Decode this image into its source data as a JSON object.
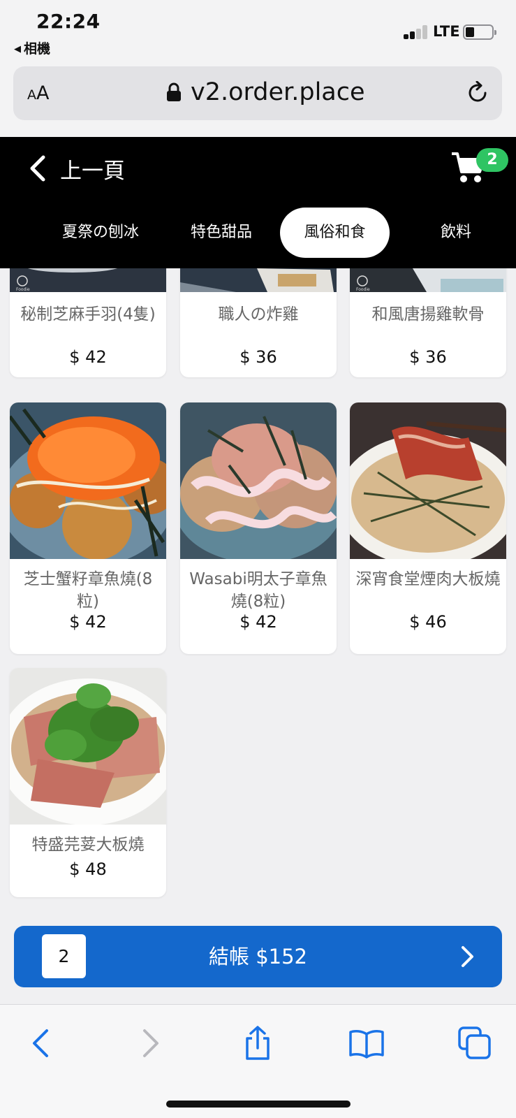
{
  "status_bar": {
    "time": "22:24",
    "back_app": "相機",
    "network": "LTE"
  },
  "browser": {
    "text_size": "AA",
    "url": "v2.order.place"
  },
  "header": {
    "back_label": "上一頁",
    "cart_count": "2"
  },
  "tabs": [
    {
      "label": "夏祭の刨冰",
      "active": false
    },
    {
      "label": "特色甜品",
      "active": false
    },
    {
      "label": "風俗和食",
      "active": true
    },
    {
      "label": "飲料",
      "active": false
    }
  ],
  "menu_items": [
    {
      "name": "秘制芝麻手羽(4隻)",
      "price": "$ 42"
    },
    {
      "name": "職人の炸雞",
      "price": "$ 36"
    },
    {
      "name": "和風唐揚雞軟骨",
      "price": "$ 36"
    },
    {
      "name": "芝士蟹籽章魚燒(8粒)",
      "price": "$ 42"
    },
    {
      "name": "Wasabi明太子章魚燒(8粒)",
      "price": "$ 42"
    },
    {
      "name": "深宵食堂煙肉大板燒",
      "price": "$ 46"
    },
    {
      "name": "特盛芫荽大板燒",
      "price": "$ 48"
    }
  ],
  "checkout": {
    "count": "2",
    "label": "結帳 $152"
  },
  "colors": {
    "checkout_blue": "#1468cc",
    "cart_badge_green": "#2fc463",
    "header_black": "#000000"
  }
}
